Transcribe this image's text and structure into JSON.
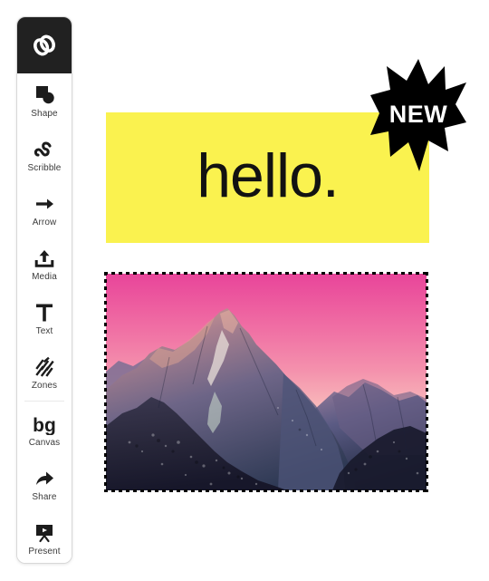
{
  "app": {
    "logo_icon": "infinity-links-logo",
    "background_color": "#ffffff"
  },
  "sidebar": {
    "items": [
      {
        "id": "shape",
        "label": "Shape",
        "icon": "shape-square-circle-icon"
      },
      {
        "id": "scribble",
        "label": "Scribble",
        "icon": "scribble-squiggle-icon"
      },
      {
        "id": "arrow",
        "label": "Arrow",
        "icon": "arrow-right-icon"
      },
      {
        "id": "media",
        "label": "Media",
        "icon": "upload-media-icon"
      },
      {
        "id": "text",
        "label": "Text",
        "icon": "text-t-icon"
      },
      {
        "id": "zones",
        "label": "Zones",
        "icon": "zones-hatch-icon"
      },
      {
        "id": "canvas",
        "label": "Canvas",
        "icon": "bg-canvas-icon"
      },
      {
        "id": "share",
        "label": "Share",
        "icon": "share-arrow-icon"
      },
      {
        "id": "present",
        "label": "Present",
        "icon": "present-screen-icon"
      }
    ],
    "divider_after": "zones"
  },
  "canvas": {
    "banner": {
      "text": "hello.",
      "background_color": "#faf24f",
      "text_color": "#121212"
    },
    "badge": {
      "text": "NEW",
      "shape": "starburst",
      "points": 11,
      "fill_color": "#000000",
      "text_color": "#ffffff"
    },
    "image": {
      "alt": "mountain-range-at-sunset",
      "selected": true,
      "selection_style": "marching-ants-dotted",
      "sky_top_color": "#e8459a",
      "sky_bottom_color": "#fefcf7",
      "mountain_color": "#2f2a4a"
    }
  }
}
